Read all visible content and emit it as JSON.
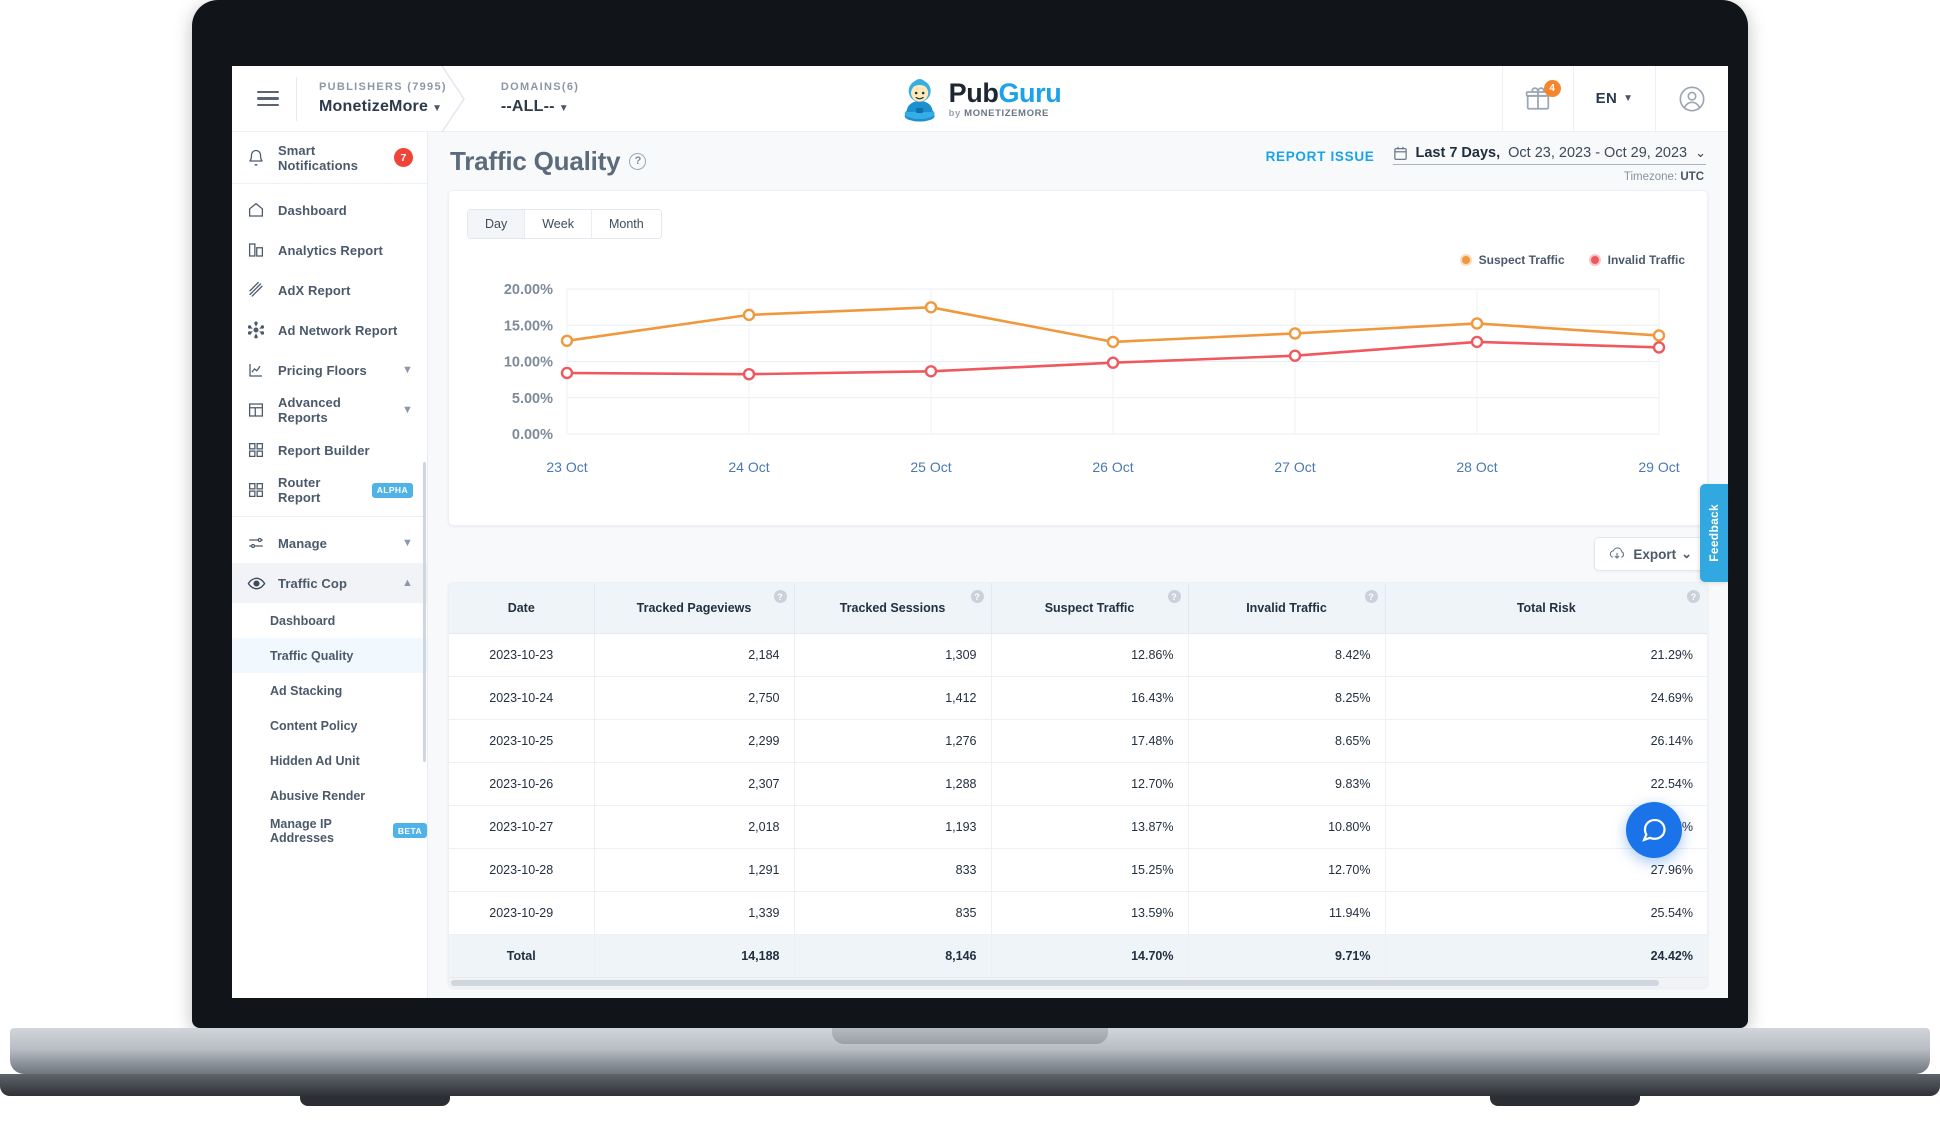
{
  "topbar": {
    "menu_icon": "hamburger-icon",
    "breadcrumbs": [
      {
        "title": "PUBLISHERS (7995)",
        "value": "MonetizeMore"
      },
      {
        "title": "DOMAINS(6)",
        "value": "--ALL--"
      }
    ],
    "logo": {
      "part1": "Pub",
      "part2": "Guru",
      "tagline_prefix": "by ",
      "tagline": "MONETIZEMORE"
    },
    "gift_badge_count": "4",
    "language": "EN",
    "account_icon": "user-avatar-icon"
  },
  "sidebar": {
    "notifications": {
      "label": "Smart Notifications",
      "count": "7",
      "icon": "bell-icon"
    },
    "items": [
      {
        "label": "Dashboard",
        "icon": "home-icon",
        "chevron": false
      },
      {
        "label": "Analytics Report",
        "icon": "bar-chart-icon",
        "chevron": false
      },
      {
        "label": "AdX Report",
        "icon": "slashes-icon",
        "chevron": false
      },
      {
        "label": "Ad Network Report",
        "icon": "network-icon",
        "chevron": false
      },
      {
        "label": "Pricing Floors",
        "icon": "line-chart-icon",
        "chevron": true
      },
      {
        "label": "Advanced Reports",
        "icon": "layout-icon",
        "chevron": true
      },
      {
        "label": "Report Builder",
        "icon": "grid-icon",
        "chevron": false
      },
      {
        "label": "Router Report",
        "icon": "grid-icon",
        "chevron": false,
        "pill": "ALPHA"
      }
    ],
    "manage": {
      "label": "Manage",
      "icon": "sliders-icon",
      "chevron": true
    },
    "traffic_cop": {
      "label": "Traffic Cop",
      "icon": "eye-icon",
      "chevron": true
    },
    "sub_items": [
      {
        "label": "Dashboard",
        "active": false
      },
      {
        "label": "Traffic Quality",
        "active": true
      },
      {
        "label": "Ad Stacking",
        "active": false
      },
      {
        "label": "Content Policy",
        "active": false
      },
      {
        "label": "Hidden Ad Unit",
        "active": false
      },
      {
        "label": "Abusive Render",
        "active": false
      },
      {
        "label": "Manage IP Addresses",
        "active": false,
        "pill": "BETA"
      }
    ]
  },
  "page": {
    "title": "Traffic Quality",
    "help_icon": "question-mark-icon",
    "report_issue": "REPORT ISSUE",
    "calendar_icon": "calendar-icon",
    "date_preset": "Last 7 Days,",
    "date_range": "Oct 23, 2023 - Oct 29, 2023",
    "timezone_label": "Timezone:",
    "timezone_value": "UTC"
  },
  "chart_controls": {
    "granularity": [
      {
        "label": "Day",
        "selected": true
      },
      {
        "label": "Week",
        "selected": false
      },
      {
        "label": "Month",
        "selected": false
      }
    ]
  },
  "export": {
    "label": "Export",
    "icon": "cloud-download-icon",
    "caret": "⌄"
  },
  "feedback_tab": {
    "label": "Feedback"
  },
  "chat_widget": {
    "icon": "chat-bubble-icon"
  },
  "chart_data": {
    "type": "line",
    "title": "",
    "xlabel": "",
    "ylabel": "",
    "x": [
      "23 Oct",
      "24 Oct",
      "25 Oct",
      "26 Oct",
      "27 Oct",
      "28 Oct",
      "29 Oct"
    ],
    "ylim": [
      0,
      20
    ],
    "ytick_labels": [
      "20.00%",
      "15.00%",
      "10.00%",
      "5.00%",
      "0.00%"
    ],
    "ytick_values": [
      20,
      15,
      10,
      5,
      0
    ],
    "grid": true,
    "legend_position": "top-right",
    "series": [
      {
        "name": "Suspect Traffic",
        "color": "#f0983c",
        "values": [
          12.86,
          16.43,
          17.48,
          12.7,
          13.87,
          15.25,
          13.59
        ]
      },
      {
        "name": "Invalid Traffic",
        "color": "#f0585f",
        "values": [
          8.42,
          8.25,
          8.65,
          9.83,
          10.8,
          12.7,
          11.94
        ]
      }
    ]
  },
  "table": {
    "columns": [
      {
        "label": "Date",
        "help": false
      },
      {
        "label": "Tracked Pageviews",
        "help": true
      },
      {
        "label": "Tracked Sessions",
        "help": true
      },
      {
        "label": "Suspect Traffic",
        "help": true
      },
      {
        "label": "Invalid Traffic",
        "help": true
      },
      {
        "label": "Total Risk",
        "help": true
      }
    ],
    "rows": [
      [
        "2023-10-23",
        "2,184",
        "1,309",
        "12.86%",
        "8.42%",
        "21.29%"
      ],
      [
        "2023-10-24",
        "2,750",
        "1,412",
        "16.43%",
        "8.25%",
        "24.69%"
      ],
      [
        "2023-10-25",
        "2,299",
        "1,276",
        "17.48%",
        "8.65%",
        "26.14%"
      ],
      [
        "2023-10-26",
        "2,307",
        "1,288",
        "12.70%",
        "9.83%",
        "22.54%"
      ],
      [
        "2023-10-27",
        "2,018",
        "1,193",
        "13.87%",
        "10.80%",
        "24.67%"
      ],
      [
        "2023-10-28",
        "1,291",
        "833",
        "15.25%",
        "12.70%",
        "27.96%"
      ],
      [
        "2023-10-29",
        "1,339",
        "835",
        "13.59%",
        "11.94%",
        "25.54%"
      ]
    ],
    "total_row": [
      "Total",
      "14,188",
      "8,146",
      "14.70%",
      "9.71%",
      "24.42%"
    ]
  },
  "colors": {
    "accent": "#1aa3e8",
    "suspect": "#f0983c",
    "invalid": "#f0585f",
    "badge_red": "#f04438",
    "gift_badge": "#f5862b"
  }
}
